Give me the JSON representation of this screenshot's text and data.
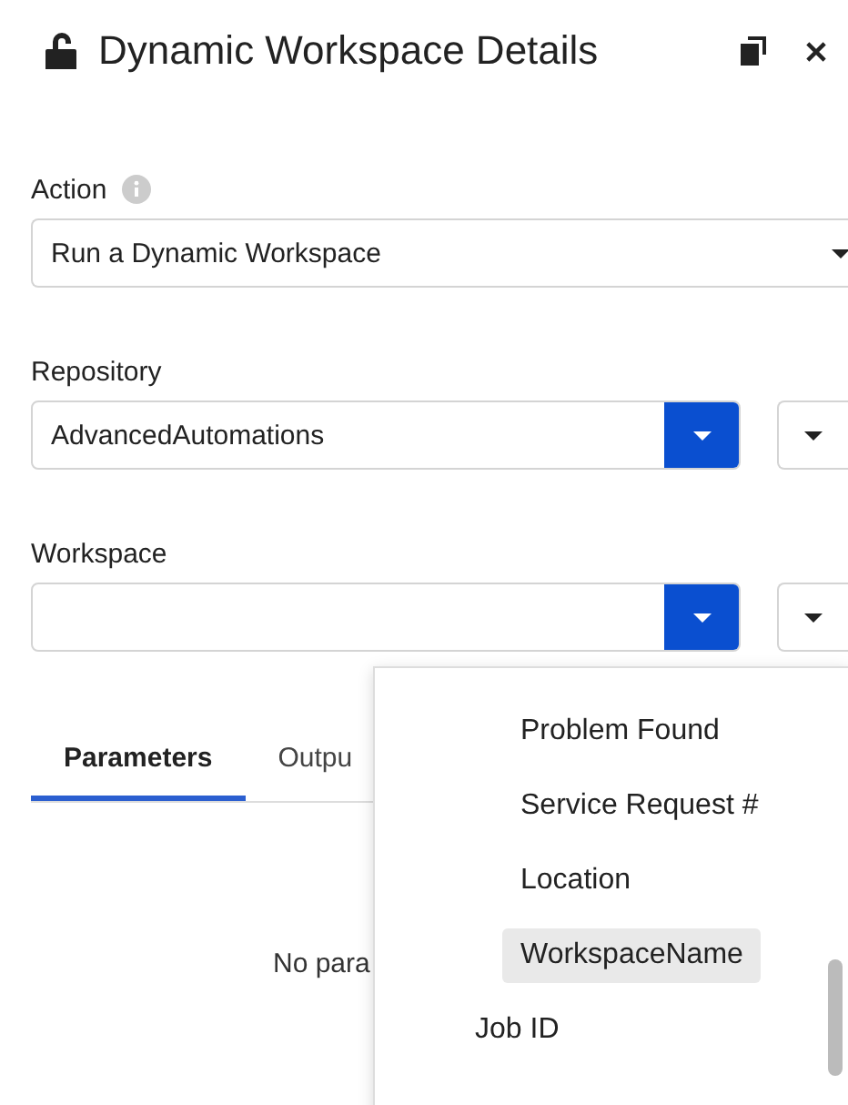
{
  "window": {
    "title": "Dynamic Workspace Details"
  },
  "action": {
    "label": "Action",
    "value": "Run a Dynamic Workspace"
  },
  "repository": {
    "label": "Repository",
    "value": "AdvancedAutomations"
  },
  "workspace": {
    "label": "Workspace"
  },
  "tabs": [
    {
      "label": "Parameters",
      "selected": true
    },
    {
      "label": "Outpu",
      "selected": false
    }
  ],
  "empty_message": "No para",
  "menu": {
    "items": [
      {
        "label": "Problem Found",
        "kind": "nested",
        "selected": false
      },
      {
        "label": "Service Request #",
        "kind": "nested",
        "selected": false
      },
      {
        "label": "Location",
        "kind": "nested",
        "selected": false
      },
      {
        "label": "WorkspaceName",
        "kind": "nested",
        "selected": true
      },
      {
        "label": "Job ID",
        "kind": "top",
        "selected": false
      }
    ]
  }
}
